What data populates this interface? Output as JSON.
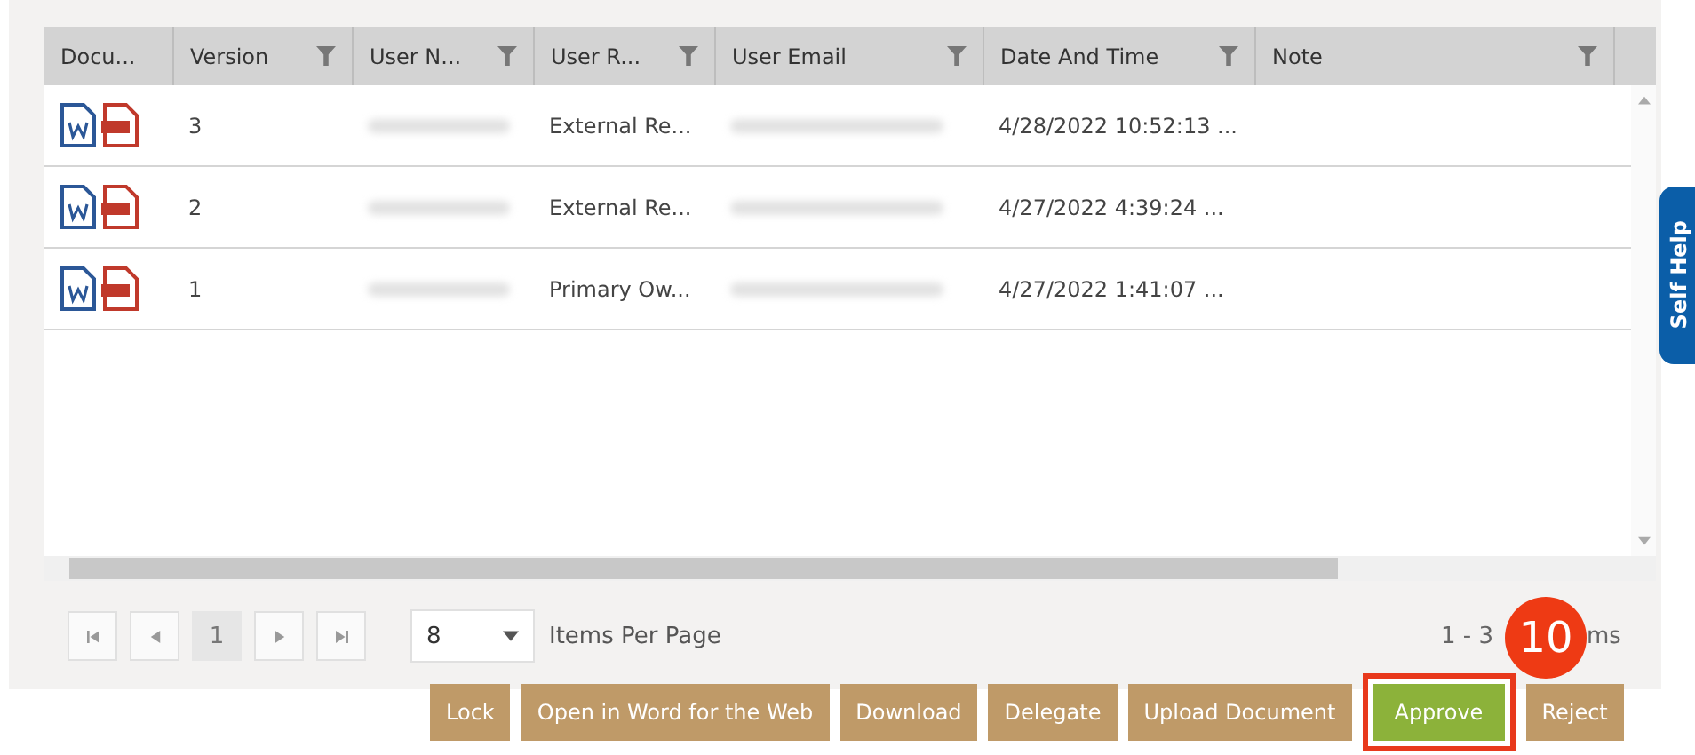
{
  "table": {
    "columns": [
      {
        "label": "Docu...",
        "filter": false
      },
      {
        "label": "Version",
        "filter": true
      },
      {
        "label": "User N...",
        "filter": true
      },
      {
        "label": "User R...",
        "filter": true
      },
      {
        "label": "User Email",
        "filter": true
      },
      {
        "label": "Date And Time",
        "filter": true
      },
      {
        "label": "Note",
        "filter": true
      }
    ],
    "rows": [
      {
        "version": "3",
        "user_role": "External Re...",
        "date_time": "4/28/2022 10:52:13 ..."
      },
      {
        "version": "2",
        "user_role": "External Re...",
        "date_time": "4/27/2022 4:39:24 ..."
      },
      {
        "version": "1",
        "user_role": "Primary Ow...",
        "date_time": "4/27/2022 1:41:07 ..."
      }
    ]
  },
  "pager": {
    "pages": [
      {
        "label": "1",
        "selected": true
      }
    ],
    "page_size": "8",
    "page_size_label": "Items Per Page",
    "summary_start": "1 - 3",
    "summary_end": "ms"
  },
  "step_badge": "10",
  "self_help": "Self Help",
  "buttons": [
    {
      "label": "Lock",
      "kind": "normal",
      "highlighted": false
    },
    {
      "label": "Open in Word for the Web",
      "kind": "normal",
      "highlighted": false
    },
    {
      "label": "Download",
      "kind": "normal",
      "highlighted": false
    },
    {
      "label": "Delegate",
      "kind": "normal",
      "highlighted": false
    },
    {
      "label": "Upload Document",
      "kind": "normal",
      "highlighted": false
    },
    {
      "label": "Approve",
      "kind": "approve",
      "highlighted": true
    },
    {
      "label": "Reject",
      "kind": "normal",
      "highlighted": false
    }
  ]
}
